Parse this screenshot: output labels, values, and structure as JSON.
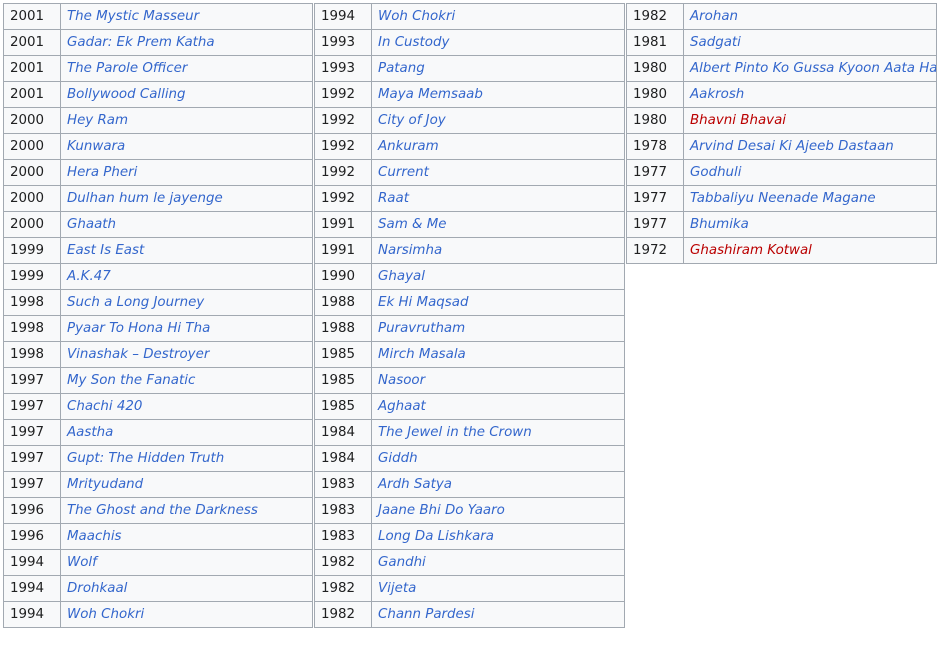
{
  "tables": [
    {
      "rows": [
        {
          "year": "2001",
          "title": "The Mystic Masseur"
        },
        {
          "year": "2001",
          "title": "Gadar: Ek Prem Katha"
        },
        {
          "year": "2001",
          "title": "The Parole Officer"
        },
        {
          "year": "2001",
          "title": "Bollywood Calling"
        },
        {
          "year": "2000",
          "title": "Hey Ram"
        },
        {
          "year": "2000",
          "title": "Kunwara"
        },
        {
          "year": "2000",
          "title": "Hera Pheri"
        },
        {
          "year": "2000",
          "title": "Dulhan hum le jayenge"
        },
        {
          "year": "2000",
          "title": "Ghaath"
        },
        {
          "year": "1999",
          "title": "East Is East"
        },
        {
          "year": "1999",
          "title": "A.K.47"
        },
        {
          "year": "1998",
          "title": "Such a Long Journey"
        },
        {
          "year": "1998",
          "title": "Pyaar To Hona Hi Tha"
        },
        {
          "year": "1998",
          "title": "Vinashak – Destroyer"
        },
        {
          "year": "1997",
          "title": "My Son the Fanatic"
        },
        {
          "year": "1997",
          "title": "Chachi 420"
        },
        {
          "year": "1997",
          "title": "Aastha"
        },
        {
          "year": "1997",
          "title": "Gupt: The Hidden Truth"
        },
        {
          "year": "1997",
          "title": "Mrityudand"
        },
        {
          "year": "1996",
          "title": "The Ghost and the Darkness"
        },
        {
          "year": "1996",
          "title": "Maachis"
        },
        {
          "year": "1994",
          "title": "Wolf"
        },
        {
          "year": "1994",
          "title": "Drohkaal"
        },
        {
          "year": "1994",
          "title": "Woh Chokri"
        }
      ]
    },
    {
      "rows": [
        {
          "year": "1994",
          "title": "Woh Chokri"
        },
        {
          "year": "1993",
          "title": "In Custody"
        },
        {
          "year": "1993",
          "title": "Patang"
        },
        {
          "year": "1992",
          "title": "Maya Memsaab"
        },
        {
          "year": "1992",
          "title": "City of Joy"
        },
        {
          "year": "1992",
          "title": "Ankuram"
        },
        {
          "year": "1992",
          "title": "Current"
        },
        {
          "year": "1992",
          "title": "Raat"
        },
        {
          "year": "1991",
          "title": "Sam & Me"
        },
        {
          "year": "1991",
          "title": "Narsimha"
        },
        {
          "year": "1990",
          "title": "Ghayal"
        },
        {
          "year": "1988",
          "title": "Ek Hi Maqsad"
        },
        {
          "year": "1988",
          "title": "Puravrutham"
        },
        {
          "year": "1985",
          "title": "Mirch Masala"
        },
        {
          "year": "1985",
          "title": "Nasoor"
        },
        {
          "year": "1985",
          "title": "Aghaat"
        },
        {
          "year": "1984",
          "title": "The Jewel in the Crown"
        },
        {
          "year": "1984",
          "title": "Giddh"
        },
        {
          "year": "1983",
          "title": "Ardh Satya"
        },
        {
          "year": "1983",
          "title": "Jaane Bhi Do Yaaro"
        },
        {
          "year": "1983",
          "title": "Long Da Lishkara"
        },
        {
          "year": "1982",
          "title": "Gandhi"
        },
        {
          "year": "1982",
          "title": "Vijeta"
        },
        {
          "year": "1982",
          "title": "Chann Pardesi"
        }
      ]
    },
    {
      "rows": [
        {
          "year": "1982",
          "title": "Arohan"
        },
        {
          "year": "1981",
          "title": "Sadgati"
        },
        {
          "year": "1980",
          "title": "Albert Pinto Ko Gussa Kyoon Aata Hai"
        },
        {
          "year": "1980",
          "title": "Aakrosh"
        },
        {
          "year": "1980",
          "title": "Bhavni Bhavai",
          "redlink": true
        },
        {
          "year": "1978",
          "title": "Arvind Desai Ki Ajeeb Dastaan"
        },
        {
          "year": "1977",
          "title": "Godhuli"
        },
        {
          "year": "1977",
          "title": "Tabbaliyu Neenade Magane"
        },
        {
          "year": "1977",
          "title": "Bhumika"
        },
        {
          "year": "1972",
          "title": "Ghashiram Kotwal",
          "redlink": true
        }
      ]
    }
  ],
  "colors": {
    "link": "#3366cc",
    "redlink": "#ba0000",
    "text": "#202122",
    "cell_bg": "#f8f9fa",
    "border": "#a2a9b1"
  }
}
